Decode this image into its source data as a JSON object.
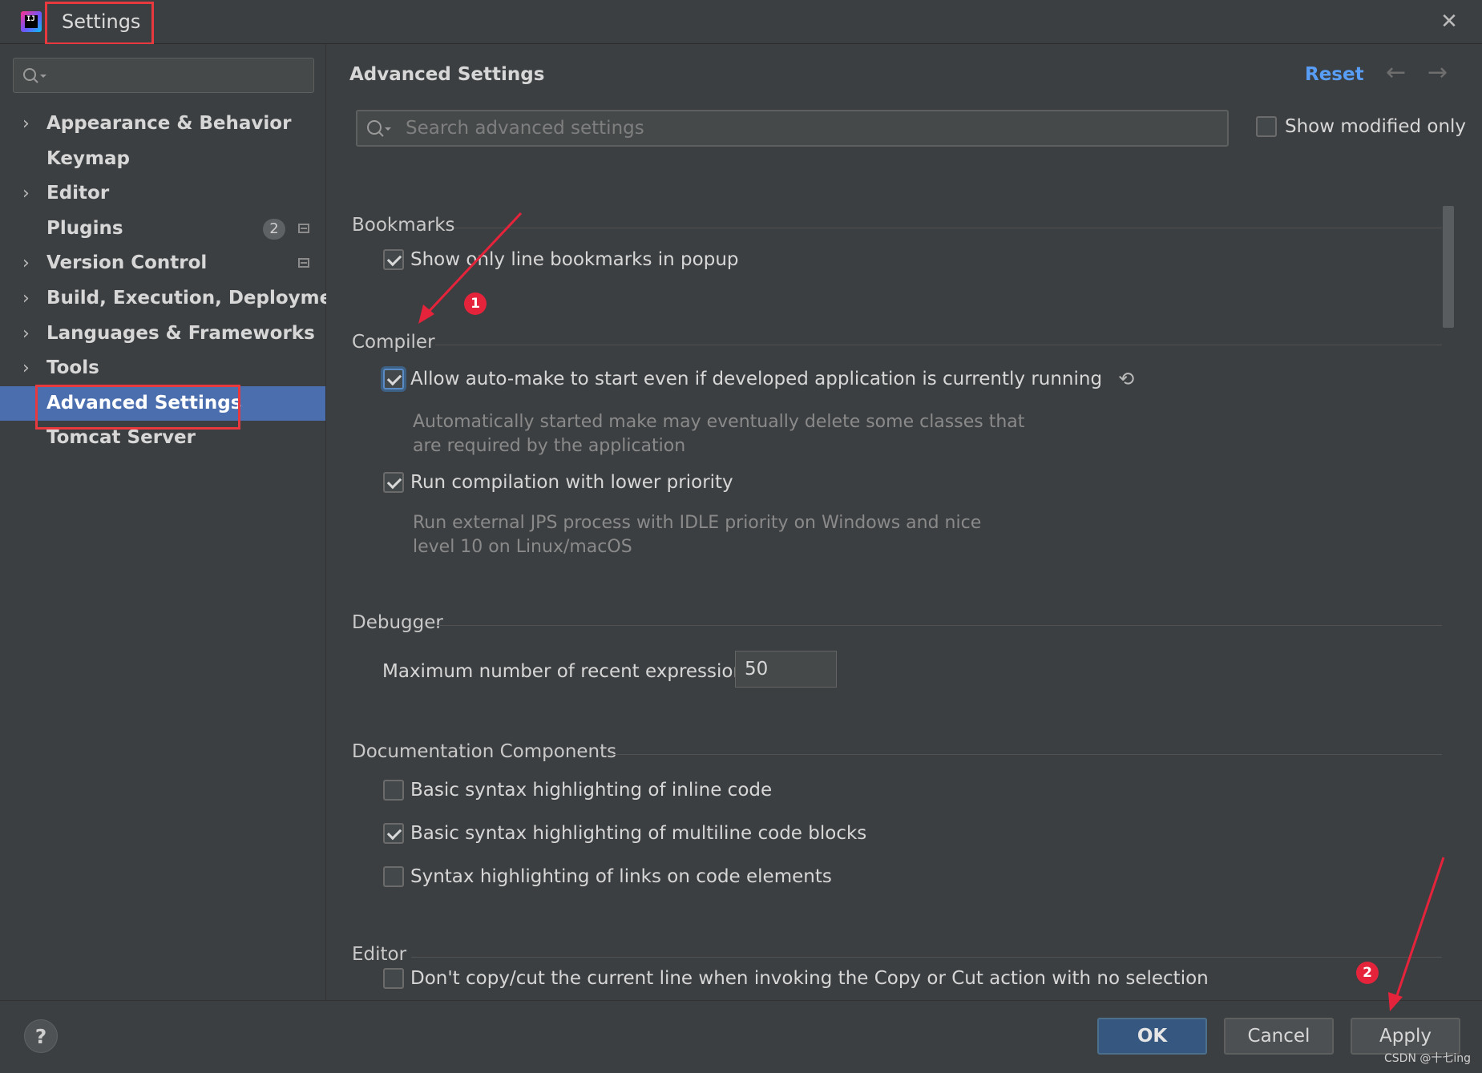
{
  "window": {
    "title": "Settings",
    "close_glyph": "✕",
    "logo_text": "IJ"
  },
  "sidebar": {
    "search_placeholder": "",
    "items": [
      {
        "label": "Appearance & Behavior",
        "expandable": true,
        "arrow": "›"
      },
      {
        "label": "Keymap",
        "expandable": false
      },
      {
        "label": "Editor",
        "expandable": true,
        "arrow": "›"
      },
      {
        "label": "Plugins",
        "expandable": false,
        "badge": "2"
      },
      {
        "label": "Version Control",
        "expandable": true,
        "arrow": "›"
      },
      {
        "label": "Build, Execution, Deployment",
        "expandable": true,
        "arrow": "›"
      },
      {
        "label": "Languages & Frameworks",
        "expandable": true,
        "arrow": "›"
      },
      {
        "label": "Tools",
        "expandable": true,
        "arrow": "›"
      },
      {
        "label": "Advanced Settings",
        "expandable": false,
        "selected": true
      },
      {
        "label": "Tomcat Server",
        "expandable": false
      }
    ]
  },
  "main": {
    "title": "Advanced Settings",
    "reset_label": "Reset",
    "back_glyph": "←",
    "forward_glyph": "→",
    "search_placeholder": "Search advanced settings",
    "show_modified_label": "Show modified only",
    "sections": {
      "bookmarks": {
        "title": "Bookmarks",
        "opt1": "Show only line bookmarks in popup"
      },
      "compiler": {
        "title": "Compiler",
        "opt1": "Allow auto-make to start even if developed application is currently running",
        "opt1_desc_1": "Automatically started make may eventually delete some classes that",
        "opt1_desc_2": "are required by the application",
        "opt2": "Run compilation with lower priority",
        "opt2_desc_1": "Run external JPS process with IDLE priority on Windows and nice",
        "opt2_desc_2": "level 10 on Linux/macOS",
        "undo_glyph": "⟲"
      },
      "debugger": {
        "title": "Debugger",
        "field_label": "Maximum number of recent expressions:",
        "field_value": "50"
      },
      "documentation": {
        "title": "Documentation Components",
        "opt1": "Basic syntax highlighting of inline code",
        "opt2": "Basic syntax highlighting of multiline code blocks",
        "opt3": "Syntax highlighting of links on code elements"
      },
      "editor": {
        "title": "Editor",
        "opt1": "Don't copy/cut the current line when invoking the Copy or Cut action with no selection"
      }
    }
  },
  "footer": {
    "help_label": "?",
    "ok_label": "OK",
    "cancel_label": "Cancel",
    "apply_label": "Apply",
    "watermark": "CSDN @十七ing"
  },
  "annotations": {
    "marker1": "1",
    "marker2": "2",
    "color": "#e5233b"
  }
}
